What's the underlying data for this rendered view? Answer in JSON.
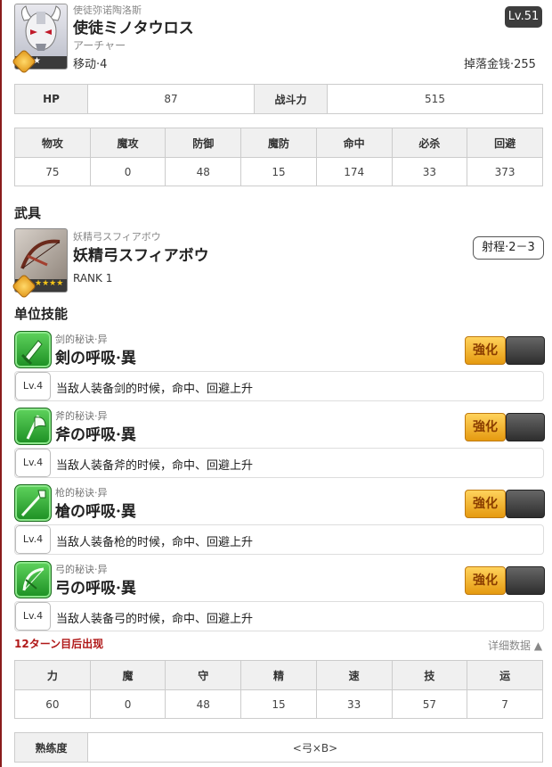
{
  "unit": {
    "subtitle": "使徒弥诺陶洛斯",
    "name": "使徒ミノタウロス",
    "class": "アーチャー",
    "move_label": "移动·",
    "move_value": "4",
    "level": "Lv.51",
    "drop_label": "掉落金钱·",
    "drop_value": "255"
  },
  "summary": {
    "hp_label": "HP",
    "hp_value": "87",
    "power_label": "战斗力",
    "power_value": "515"
  },
  "stats": {
    "headers": [
      "物攻",
      "魔攻",
      "防御",
      "魔防",
      "命中",
      "必杀",
      "回避"
    ],
    "values": [
      "75",
      "0",
      "48",
      "15",
      "174",
      "33",
      "373"
    ]
  },
  "weapon": {
    "section": "武具",
    "subtitle": "妖精弓スフィアボウ",
    "name": "妖精弓スフィアボウ",
    "rank": "RANK 1",
    "stars": "★★★★",
    "range": "射程·2－3"
  },
  "skills_section": "单位技能",
  "skills": [
    {
      "category": "剑的秘诀·异",
      "name": "剣の呼吸·異",
      "level": "Lv.4",
      "desc": "当敌人装备剑的时候，命中、回避上升",
      "enhance": "強化"
    },
    {
      "category": "斧的秘诀·异",
      "name": "斧の呼吸·異",
      "level": "Lv.4",
      "desc": "当敌人装备斧的时候，命中、回避上升",
      "enhance": "強化"
    },
    {
      "category": "枪的秘诀·异",
      "name": "槍の呼吸·異",
      "level": "Lv.4",
      "desc": "当敌人装备枪的时候，命中、回避上升",
      "enhance": "強化"
    },
    {
      "category": "弓的秘诀·异",
      "name": "弓の呼吸·異",
      "level": "Lv.4",
      "desc": "当敌人装备弓的时候，命中、回避上升",
      "enhance": "強化"
    }
  ],
  "appear_text": "12ターン目后出现",
  "detail_link": "详细数据 ▲",
  "attributes": {
    "headers": [
      "力",
      "魔",
      "守",
      "精",
      "速",
      "技",
      "运"
    ],
    "values": [
      "60",
      "0",
      "48",
      "15",
      "33",
      "57",
      "7"
    ]
  },
  "proficiency": {
    "label": "熟练度",
    "value": "<弓×B>"
  },
  "icons": {
    "skill_icons": [
      "sword-icon",
      "axe-icon",
      "spear-icon",
      "bow-icon"
    ],
    "rank_star": "star-icon"
  },
  "colors": {
    "accent_red": "#b01818",
    "skill_green": "#2aa52f",
    "enhance_gold": "#e59a10"
  }
}
